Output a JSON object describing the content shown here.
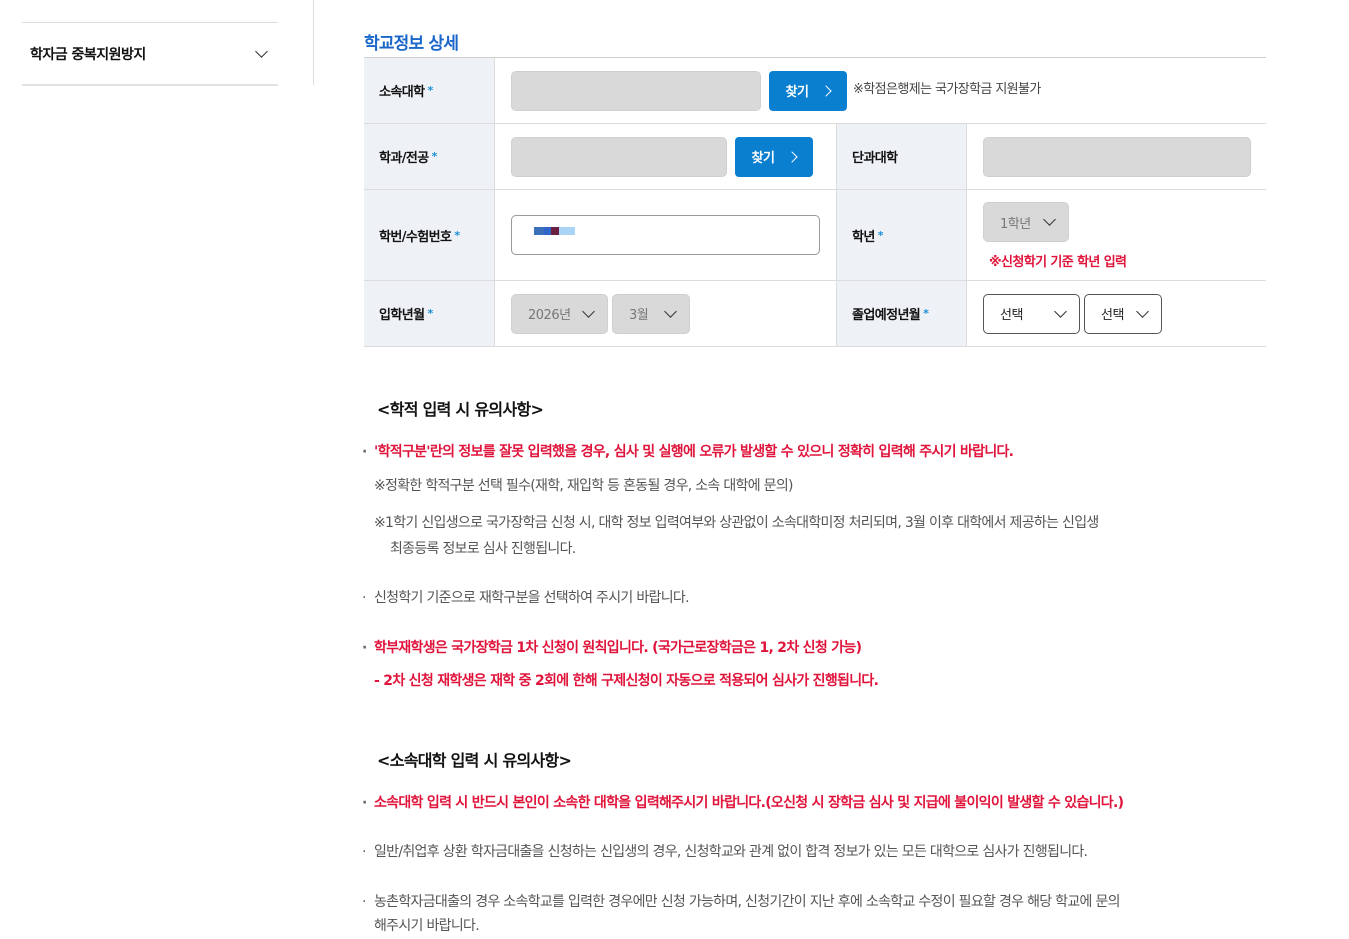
{
  "sidebar": {
    "items": [
      {
        "label": "학자금 중복지원방지"
      }
    ]
  },
  "section": {
    "title": "학교정보 상세"
  },
  "form": {
    "required_mark": "*",
    "university": {
      "label": "소속대학",
      "value": "",
      "find_button": "찾기",
      "note": "※학점은행제는 국가장학금 지원불가"
    },
    "department": {
      "label": "학과/전공",
      "value": "",
      "find_button": "찾기"
    },
    "college": {
      "label": "단과대학",
      "value": ""
    },
    "student_id": {
      "label": "학번/수험번호"
    },
    "grade": {
      "label": "학년",
      "selected": "1학년",
      "note": "※신청학기 기준 학년 입력"
    },
    "admission": {
      "label": "입학년월",
      "year": "2026년",
      "month": "3월"
    },
    "graduation": {
      "label": "졸업예정년월",
      "year": "선택",
      "month": "선택"
    }
  },
  "notices": {
    "academic": {
      "title": "<학적 입력 시 유의사항>",
      "lines": [
        "'학적구분'란의 정보를 잘못 입력했을 경우, 심사 및 실행에 오류가 발생할 수 있으니 정확히 입력해 주시기 바랍니다.",
        "※정확한 학적구분 선택 필수(재학, 재입학 등 혼동될 경우, 소속 대학에 문의)",
        "※1학기 신입생으로 국가장학금 신청 시, 대학 정보 입력여부와 상관없이 소속대학미정 처리되며, 3월 이후 대학에서 제공하는 신입생",
        "최종등록 정보로 심사 진행됩니다.",
        "신청학기 기준으로 재학구분을 선택하여 주시기 바랍니다.",
        "학부재학생은 국가장학금 1차 신청이 원칙입니다. (국가근로장학금은 1, 2차 신청 가능)",
        "- 2차 신청 재학생은 재학 중 2회에 한해 구제신청이 자동으로 적용되어 심사가 진행됩니다."
      ]
    },
    "university": {
      "title": "<소속대학 입력 시 유의사항>",
      "lines": [
        "소속대학 입력 시 반드시 본인이 소속한 대학을 입력해주시기 바랍니다.(오신청 시 장학금 심사 및 지급에 불이익이 발생할 수 있습니다.)",
        "일반/취업후 상환 학자금대출을 신청하는 신입생의 경우, 신청학교와 관계 없이 합격 정보가 있는 모든 대학으로 심사가 진행됩니다.",
        "농촌학자금대출의 경우 소속학교를 입력한 경우에만 신청 가능하며, 신청기간이 지난 후에 소속학교 수정이 필요할 경우 해당 학교에 문의",
        "해주시기 바랍니다."
      ]
    }
  },
  "colors": {
    "accent": "#1b67c9",
    "button": "#0a7fd0",
    "warning": "#e0143b",
    "header_bg": "#eef1f6"
  }
}
